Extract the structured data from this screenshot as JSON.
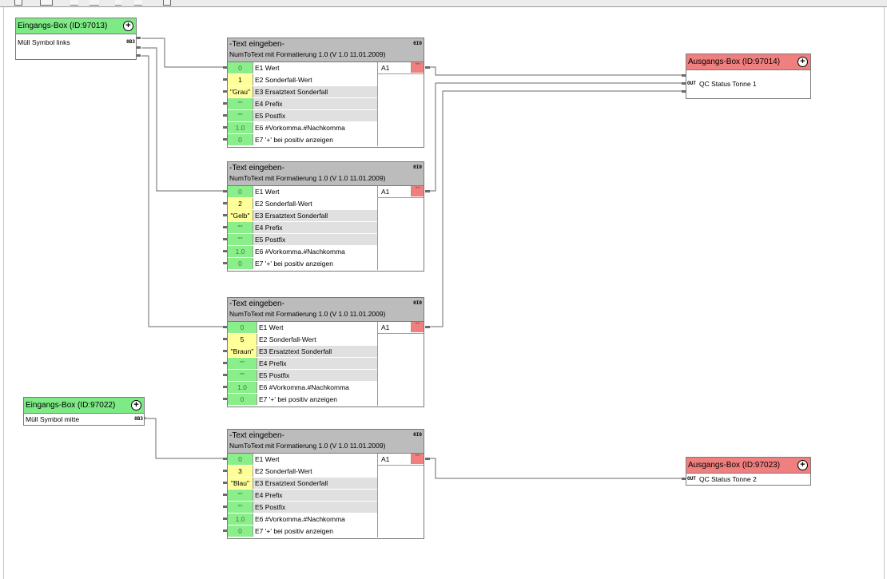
{
  "colors": {
    "input_header": "#7eea86",
    "output_header": "#f07f7f",
    "block_header": "#bcbcbc",
    "default_value": "#8aee8a",
    "set_value": "#ffff9a",
    "output_value": "#f07f7f"
  },
  "inputs": [
    {
      "title": "Eingangs-Box (ID:97013)",
      "label": "Müll Symbol links",
      "tag": "0B3"
    },
    {
      "title": "Eingangs-Box (ID:97022)",
      "label": "Müll Symbol mitte",
      "tag": "0B3"
    }
  ],
  "outputs": [
    {
      "title": "Ausgangs-Box (ID:97014)",
      "label": "QC Status Tonne 1",
      "tag": "OUT"
    },
    {
      "title": "Ausgangs-Box (ID:97023)",
      "label": "QC Status Tonne 2",
      "tag": "OUT"
    }
  ],
  "blocks": [
    {
      "title": "-Text eingeben-",
      "subtitle": "NumToText mit Formatierung 1.0 (V 1.0 11.01.2009)",
      "info": "0I0",
      "output_label": "A1",
      "output_value": "\"\"",
      "rows": [
        {
          "value": "0",
          "name": "E1 Wert"
        },
        {
          "value": "1",
          "name": "E2 Sonderfall-Wert"
        },
        {
          "value": "\"Grau\"",
          "name": "E3 Ersatztext Sonderfall"
        },
        {
          "value": "\"\"",
          "name": "E4 Prefix"
        },
        {
          "value": "\"\"",
          "name": "E5 Postfix"
        },
        {
          "value": "1.0",
          "name": "E6 #Vorkomma.#Nachkomma"
        },
        {
          "value": "0",
          "name": "E7 '+' bei positiv anzeigen"
        }
      ]
    },
    {
      "title": "-Text eingeben-",
      "subtitle": "NumToText mit Formatierung 1.0 (V 1.0 11.01.2009)",
      "info": "0I0",
      "output_label": "A1",
      "output_value": "\"\"",
      "rows": [
        {
          "value": "0",
          "name": "E1 Wert"
        },
        {
          "value": "2",
          "name": "E2 Sonderfall-Wert"
        },
        {
          "value": "\"Gelb\"",
          "name": "E3 Ersatztext Sonderfall"
        },
        {
          "value": "\"\"",
          "name": "E4 Prefix"
        },
        {
          "value": "\"\"",
          "name": "E5 Postfix"
        },
        {
          "value": "1.0",
          "name": "E6 #Vorkomma.#Nachkomma"
        },
        {
          "value": "0",
          "name": "E7 '+' bei positiv anzeigen"
        }
      ]
    },
    {
      "title": "-Text eingeben-",
      "subtitle": "NumToText mit Formatierung 1.0 (V 1.0 11.01.2009)",
      "info": "0I0",
      "output_label": "A1",
      "output_value": "\"\"",
      "rows": [
        {
          "value": "0",
          "name": "E1 Wert"
        },
        {
          "value": "5",
          "name": "E2 Sonderfall-Wert"
        },
        {
          "value": "\"Braun\"",
          "name": "E3 Ersatztext Sonderfall"
        },
        {
          "value": "\"\"",
          "name": "E4 Prefix"
        },
        {
          "value": "\"\"",
          "name": "E5 Postfix"
        },
        {
          "value": "1.0",
          "name": "E6 #Vorkomma.#Nachkomma"
        },
        {
          "value": "0",
          "name": "E7 '+' bei positiv anzeigen"
        }
      ]
    },
    {
      "title": "-Text eingeben-",
      "subtitle": "NumToText mit Formatierung 1.0 (V 1.0 11.01.2009)",
      "info": "0I0",
      "output_label": "A1",
      "output_value": "\"\"",
      "rows": [
        {
          "value": "0",
          "name": "E1 Wert"
        },
        {
          "value": "3",
          "name": "E2 Sonderfall-Wert"
        },
        {
          "value": "\"Blau\"",
          "name": "E3 Ersatztext Sonderfall"
        },
        {
          "value": "\"\"",
          "name": "E4 Prefix"
        },
        {
          "value": "\"\"",
          "name": "E5 Postfix"
        },
        {
          "value": "1.0",
          "name": "E6 #Vorkomma.#Nachkomma"
        },
        {
          "value": "0",
          "name": "E7 '+' bei positiv anzeigen"
        }
      ]
    }
  ]
}
